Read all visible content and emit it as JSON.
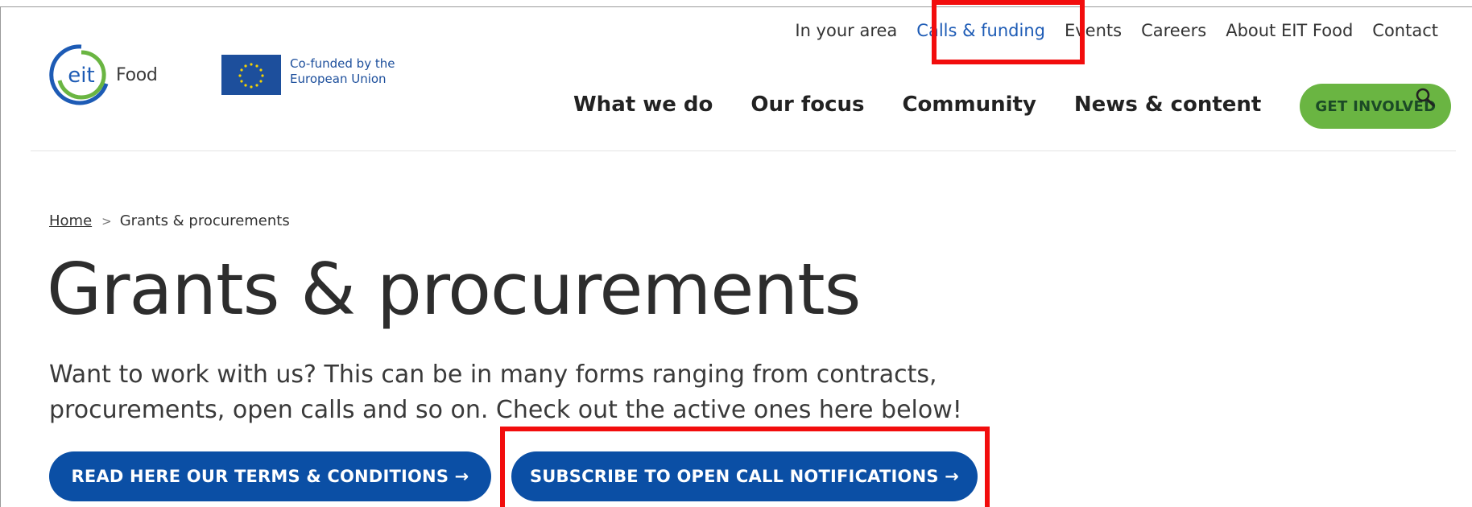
{
  "brand": {
    "logo_mark": "eit",
    "logo_word": "Food",
    "eu_line1": "Co-funded by the",
    "eu_line2": "European Union",
    "colors": {
      "eit_blue": "#1d5bb5",
      "eit_green": "#6ab542",
      "eu_blue": "#1d4f9c"
    }
  },
  "utility_nav": [
    {
      "label": "In your area"
    },
    {
      "label": "Calls & funding",
      "active": true
    },
    {
      "label": "Events"
    },
    {
      "label": "Careers"
    },
    {
      "label": "About EIT Food"
    },
    {
      "label": "Contact"
    }
  ],
  "main_nav": {
    "items": [
      "What we do",
      "Our focus",
      "Community",
      "News & content"
    ],
    "cta_label": "GET INVOLVED",
    "search_icon": "search-icon"
  },
  "breadcrumb": {
    "home": "Home",
    "separator": ">",
    "current": "Grants & procurements"
  },
  "page": {
    "title": "Grants & procurements",
    "intro": "Want to work with us? This can be in many forms ranging from contracts, procurements, open calls and so on. Check out the active ones here below!",
    "buttons": {
      "terms": "READ HERE OUR TERMS & CONDITIONS →",
      "subscribe": "SUBSCRIBE TO OPEN CALL NOTIFICATIONS →"
    },
    "button_color": "#0b4fa5"
  },
  "highlights": {
    "color": "#f20d0d"
  }
}
